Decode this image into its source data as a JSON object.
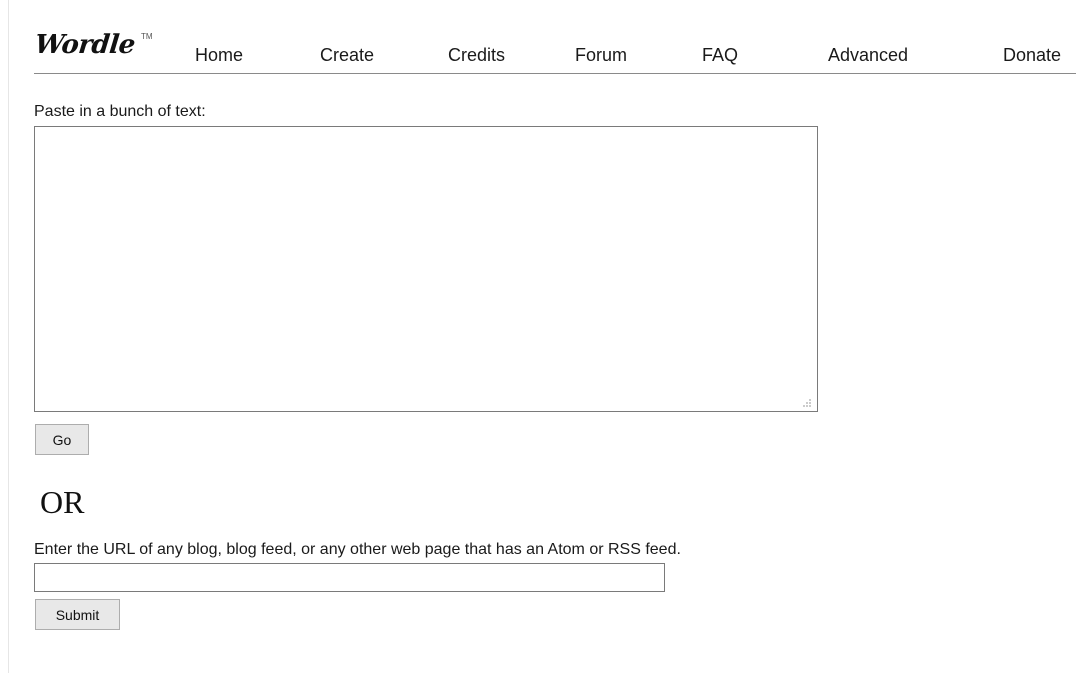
{
  "header": {
    "logo": "Wordle",
    "trademark": "TM",
    "nav": [
      {
        "label": "Home"
      },
      {
        "label": "Create"
      },
      {
        "label": "Credits"
      },
      {
        "label": "Forum"
      },
      {
        "label": "FAQ"
      },
      {
        "label": "Advanced"
      },
      {
        "label": "Donate"
      }
    ]
  },
  "text_section": {
    "label": "Paste in a bunch of text:",
    "textarea_value": "",
    "go_label": "Go"
  },
  "or_label": "OR",
  "url_section": {
    "label": "Enter the URL of any blog, blog feed, or any other web page that has an Atom or RSS feed.",
    "input_value": "",
    "submit_label": "Submit"
  },
  "icons": {
    "resize_grip": "resize-grip-icon"
  }
}
